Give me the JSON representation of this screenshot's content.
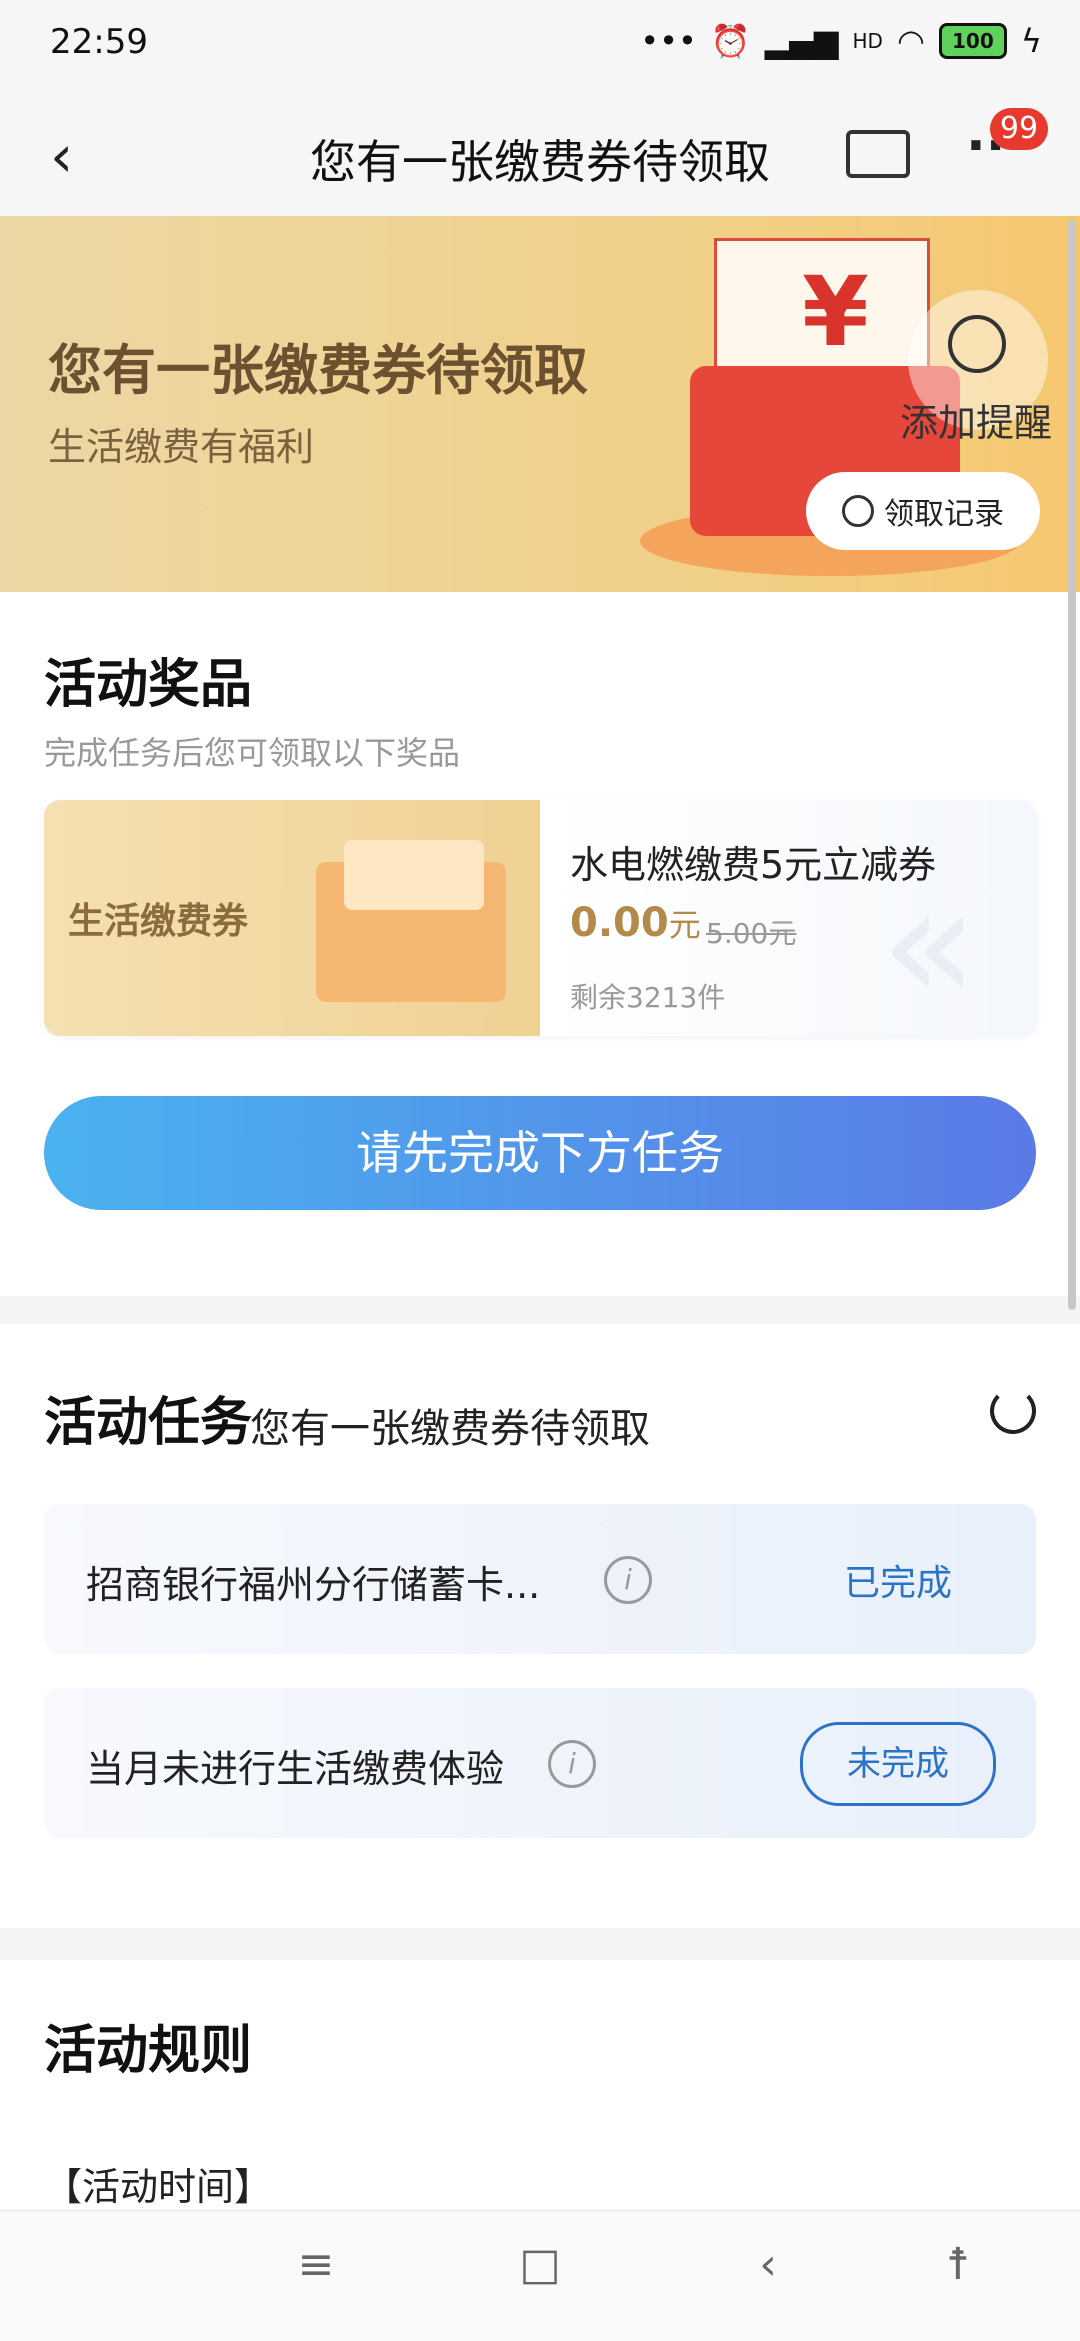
{
  "status_bar": {
    "time": "22:59",
    "battery": "100",
    "signal_text": "HD",
    "dots": "•••"
  },
  "nav": {
    "back_icon": "chevron-left-icon",
    "title": "您有一张缴费券待领取",
    "badge": "99",
    "more_label": "···"
  },
  "banner": {
    "heading": "您有一张缴费券待领取",
    "subheading": "生活缴费有福利",
    "reminder_label": "添加提醒",
    "record_label": "领取记录",
    "yen": "¥"
  },
  "prizes": {
    "title": "活动奖品",
    "subtitle": "完成任务后您可领取以下奖品",
    "card": {
      "tag": "生活缴费券",
      "name": "水电燃缴费5元立减券",
      "price": "0.00",
      "price_unit": "元",
      "original_price": "5.00元",
      "stock": "剩余3213件"
    },
    "cta_label": "请先完成下方任务"
  },
  "tasks": {
    "title": "活动任务",
    "subtitle": "您有一张缴费券待领取",
    "items": [
      {
        "label": "招商银行福州分行储蓄卡...",
        "status": "已完成"
      },
      {
        "label": "当月未进行生活缴费体验",
        "status": "未完成"
      }
    ]
  },
  "rules": {
    "title": "活动规则",
    "first_line": "【活动时间】"
  },
  "bottom_nav": {
    "menu": "≡",
    "home": "□",
    "back": "‹",
    "accessibility": "☨"
  }
}
